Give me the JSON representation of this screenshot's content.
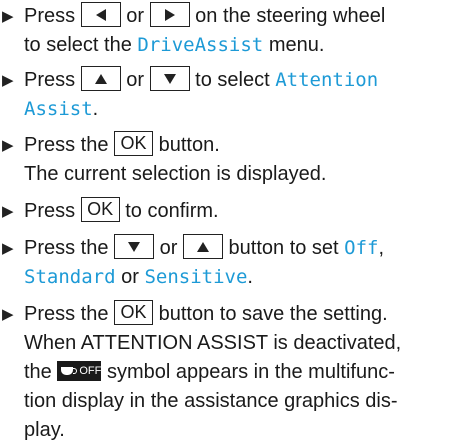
{
  "steps": [
    {
      "a": "Press",
      "b": "or",
      "c": "on the steering wheel",
      "d": "to select the",
      "e": "DriveAssist",
      "f": "menu."
    },
    {
      "a": "Press",
      "b": "or",
      "c": "to select",
      "d": "Attention",
      "e": "Assist",
      "f": "."
    },
    {
      "a": "Press the",
      "key": "OK",
      "b": "button.",
      "c": "The current selection is displayed."
    },
    {
      "a": "Press",
      "key": "OK",
      "b": "to confirm."
    },
    {
      "a": "Press the",
      "b": "or",
      "c": "button to set",
      "d": "Off",
      "e": ",",
      "f": "Standard",
      "g": "or",
      "h": "Sensitive",
      "i": "."
    },
    {
      "a": "Press the",
      "key": "OK",
      "b": "button to save the setting.",
      "c": "When ATTENTION ASSIST is deactivated,",
      "d": "the",
      "e": "symbol appears in the multifunc-",
      "f": "tion display in the assistance graphics dis-",
      "g": "play.",
      "symbol_text": "OFF"
    }
  ],
  "icons": {
    "bullet": "triangle-right-icon",
    "left": "arrow-left-key-icon",
    "right": "arrow-right-key-icon",
    "up": "arrow-up-key-icon",
    "down": "arrow-down-key-icon",
    "symbol": "attention-assist-off-symbol"
  },
  "colors": {
    "highlight": "#1d9ad6",
    "text": "#1a1a1a"
  }
}
